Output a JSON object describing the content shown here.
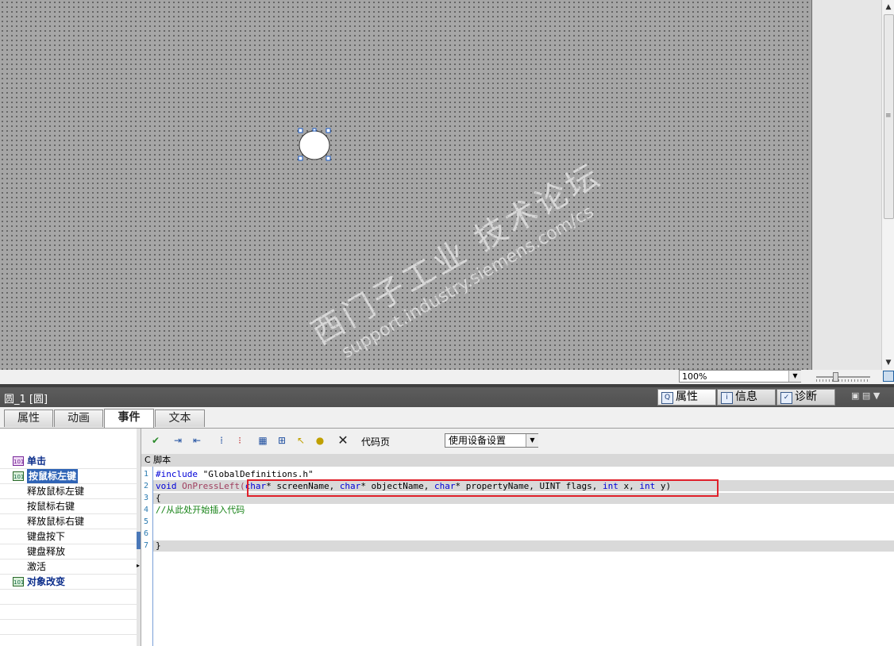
{
  "zoom": {
    "value": "100%"
  },
  "properties": {
    "object_title": "圆_1 [圆]",
    "header_tabs": [
      {
        "label": "属性",
        "icon": "properties-icon"
      },
      {
        "label": "信息",
        "icon": "info-icon"
      },
      {
        "label": "诊断",
        "icon": "diagnostics-icon"
      }
    ],
    "tabs": [
      "属性",
      "动画",
      "事件",
      "文本"
    ],
    "active_tab": "事件"
  },
  "events": [
    {
      "label": "单击",
      "bold": true,
      "icon": true
    },
    {
      "label": "按鼠标左键",
      "bold": true,
      "icon": true,
      "selected": true
    },
    {
      "label": "释放鼠标左键"
    },
    {
      "label": "按鼠标右键"
    },
    {
      "label": "释放鼠标右键"
    },
    {
      "label": "键盘按下"
    },
    {
      "label": "键盘释放"
    },
    {
      "label": "激活"
    },
    {
      "label": "对象改变",
      "bold": true,
      "icon": true
    }
  ],
  "editor_toolbar": {
    "codepage_label": "代码页",
    "codepage_value": "使用设备设置"
  },
  "script_label": "C 脚本",
  "code": {
    "line_numbers": [
      "1",
      "2",
      "3",
      "4",
      "5",
      "6",
      "7"
    ],
    "l1_directive": "#include",
    "l1_file": " \"GlobalDefinitions.h\"",
    "l2_void": "void",
    "l2_fn": " OnPressLeft(",
    "l2_char1": "char",
    "l2_p1": "* screenName, ",
    "l2_char2": "char",
    "l2_p2": "* objectName, ",
    "l2_char3": "char",
    "l2_p3": "* propertyName, UINT flags, ",
    "l2_int1": "int",
    "l2_p4": " x, ",
    "l2_int2": "int",
    "l2_p5": " y)",
    "l3": "{",
    "l4": "//从此处开始插入代码",
    "l7": "}"
  },
  "watermark": {
    "line1": "西门子工业  技术论坛",
    "line2": "support.industry.siemens.com/cs"
  }
}
